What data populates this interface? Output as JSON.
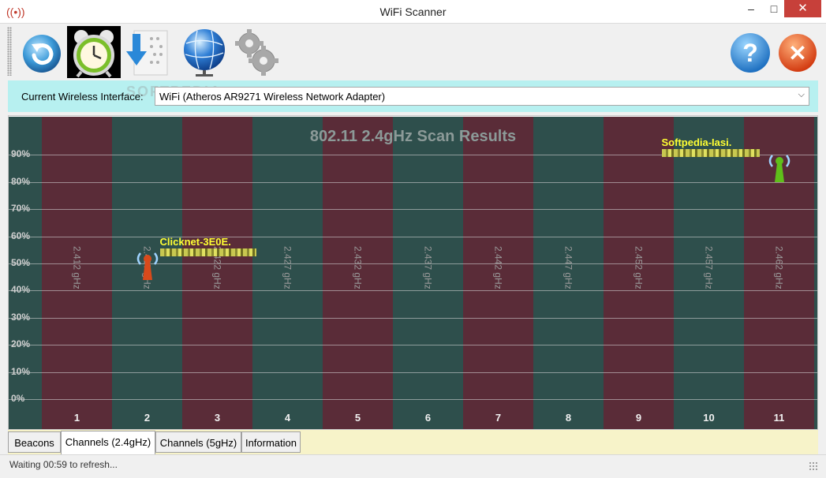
{
  "window": {
    "title": "WiFi Scanner",
    "minimize": "–",
    "maximize": "□",
    "close": "✕"
  },
  "toolbar": {
    "tools": [
      {
        "name": "refresh-button",
        "icon": "refresh-icon"
      },
      {
        "name": "timer-button",
        "icon": "alarm-clock-icon"
      },
      {
        "name": "export-button",
        "icon": "download-icon"
      },
      {
        "name": "network-button",
        "icon": "globe-icon"
      },
      {
        "name": "settings-button",
        "icon": "gears-icon"
      },
      {
        "name": "help-button",
        "icon": "help-icon",
        "glyph": "?"
      },
      {
        "name": "exit-button",
        "icon": "close-icon",
        "glyph": "✕"
      }
    ]
  },
  "interface": {
    "label": "Current Wireless Interface:",
    "selected": "WiFi (Atheros AR9271 Wireless Network Adapter)",
    "watermark": "SOFTPEDIA"
  },
  "chart_data": {
    "type": "bar",
    "title": "802.11 2.4gHz Scan Results",
    "categories": [
      "1",
      "2",
      "3",
      "4",
      "5",
      "6",
      "7",
      "8",
      "9",
      "10",
      "11"
    ],
    "frequencies": [
      "2.412 gHz",
      "2.417 gHz",
      "2.422 gHz",
      "2.427 gHz",
      "2.432 gHz",
      "2.437 gHz",
      "2.442 gHz",
      "2.447 gHz",
      "2.452 gHz",
      "2.457 gHz",
      "2.462 gHz"
    ],
    "y_ticks": [
      "0%",
      "10%",
      "20%",
      "30%",
      "40%",
      "50%",
      "60%",
      "70%",
      "80%",
      "90%"
    ],
    "ylim": [
      0,
      100
    ],
    "grid": true,
    "networks": [
      {
        "name": "Clicknet-3E0E.",
        "channel": 2,
        "signal": 52,
        "color": "#d84a1b"
      },
      {
        "name": "Softpedia-Iasi.",
        "channel": 11,
        "signal": 88,
        "color": "#5fbf1a"
      }
    ],
    "colors": {
      "red_band": "#5a2c38",
      "green_band": "#2e4f4c"
    }
  },
  "tabs": [
    {
      "label": "Beacons",
      "active": false
    },
    {
      "label": "Channels (2.4gHz)",
      "active": true
    },
    {
      "label": "Channels (5gHz)",
      "active": false
    },
    {
      "label": "Information",
      "active": false
    }
  ],
  "status": {
    "text": "Waiting 00:59 to refresh..."
  }
}
